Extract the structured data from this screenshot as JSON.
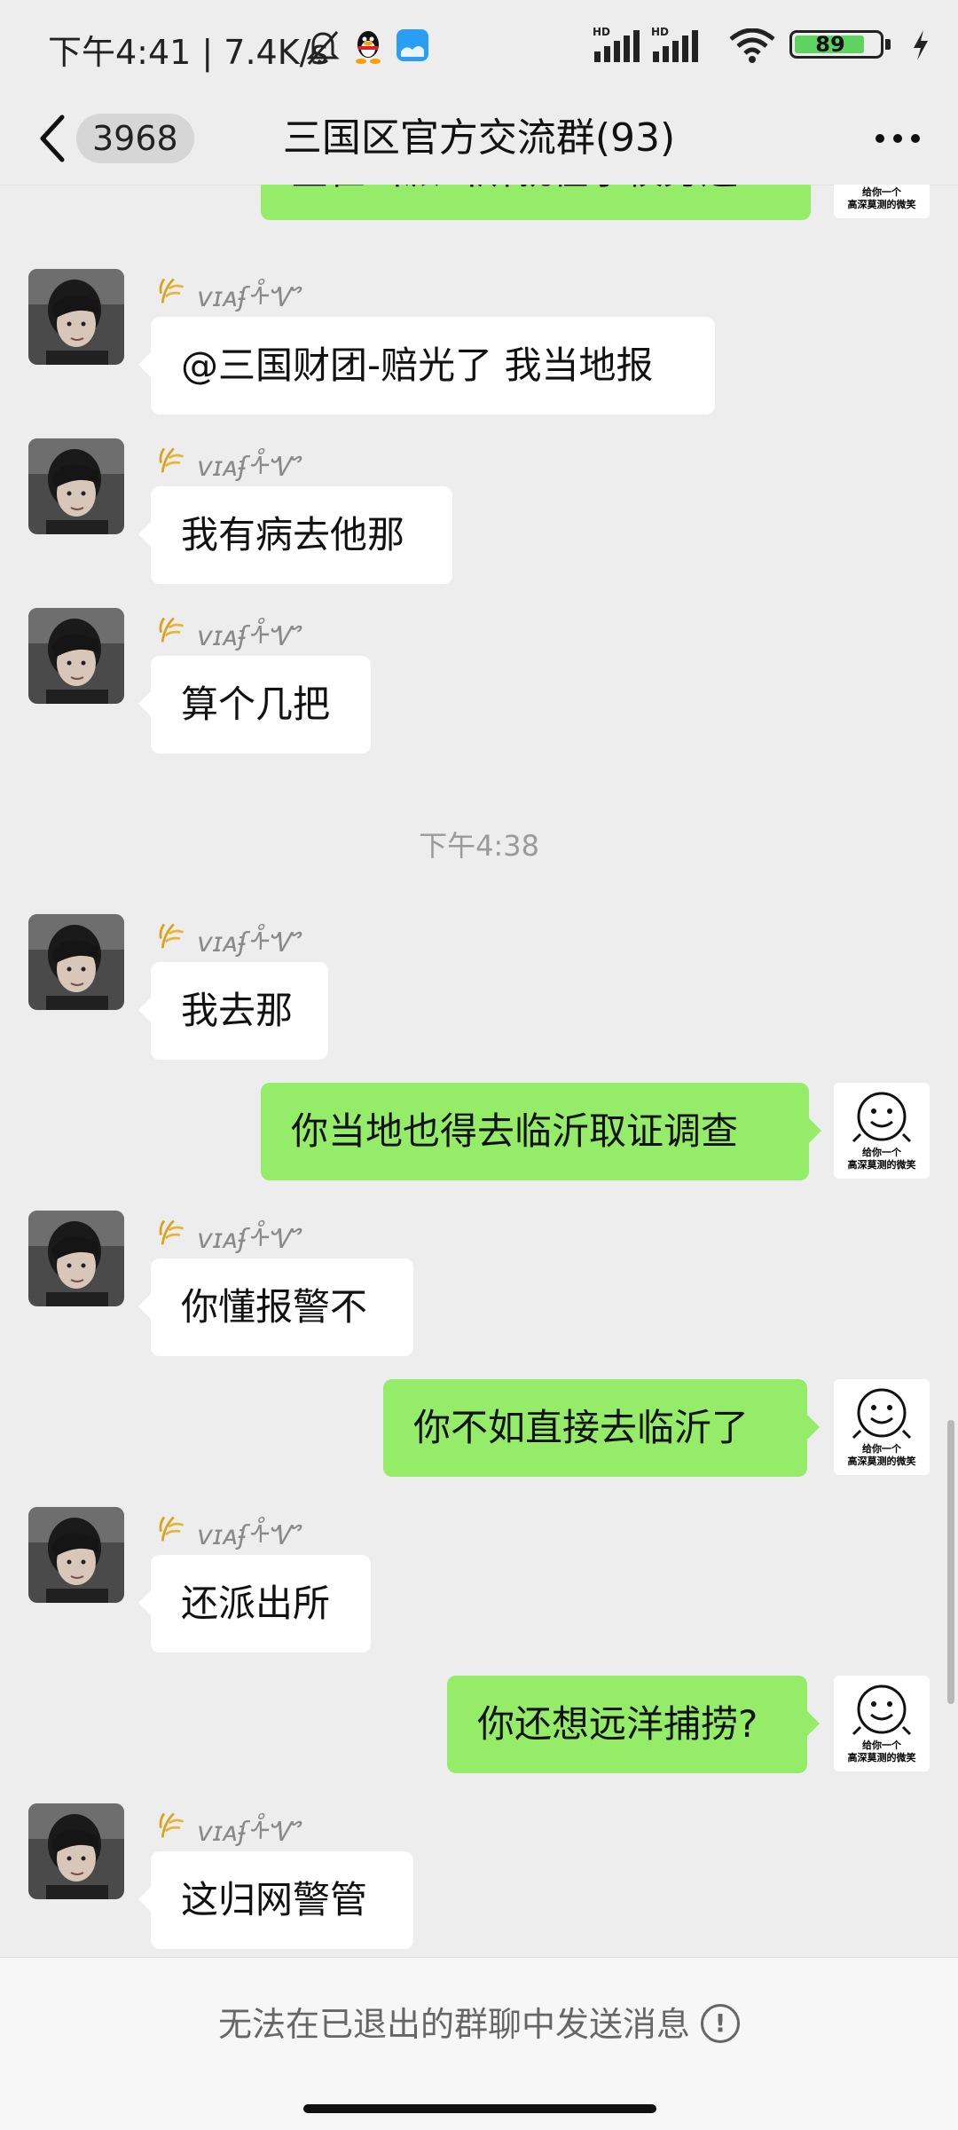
{
  "status_bar": {
    "time_text": "下午4:41 | 7.4K/s",
    "battery": "89",
    "hd_label": "HD"
  },
  "header": {
    "unread_count": "3968",
    "title": "三国区官方交流群(93)"
  },
  "nickname": "ᴠɪᴀʄᢥᏉ",
  "messages": [
    {
      "side": "out",
      "text": "金崔山派出所就在学校旁边",
      "partial": true
    },
    {
      "side": "in",
      "text": "@三国财团-赔光了  我当地报"
    },
    {
      "side": "in",
      "text": "我有病去他那"
    },
    {
      "side": "in",
      "text": "算个几把"
    },
    {
      "side": "time",
      "text": "下午4:38"
    },
    {
      "side": "in",
      "text": "我去那"
    },
    {
      "side": "out",
      "text": "你当地也得去临沂取证调查"
    },
    {
      "side": "in",
      "text": "你懂报警不"
    },
    {
      "side": "out",
      "text": "你不如直接去临沂了"
    },
    {
      "side": "in",
      "text": "还派出所"
    },
    {
      "side": "out",
      "text": "你还想远洋捕捞?"
    },
    {
      "side": "in",
      "text": "这归网警管"
    }
  ],
  "self_avatar_caption": "给你一个\n高深莫测的微笑",
  "footer": {
    "notice": "无法在已退出的群聊中发送消息"
  },
  "icons": {
    "back": "chevron-left-icon",
    "more": "more-dots-icon",
    "nick_badge": "wheat-icon",
    "notice": "exclamation-circle-icon"
  },
  "colors": {
    "background": "#ededed",
    "outgoing_bubble": "#95ec69",
    "incoming_bubble": "#ffffff",
    "battery_fill": "#5fd35f"
  }
}
